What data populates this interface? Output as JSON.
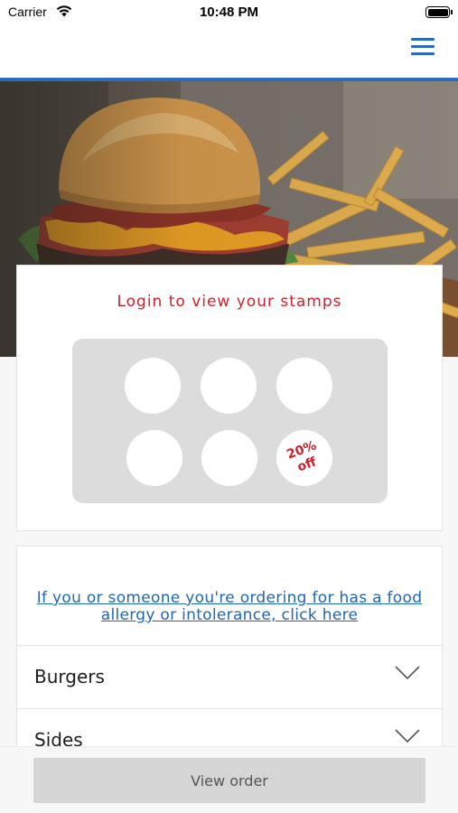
{
  "status_bar": {
    "carrier": "Carrier",
    "time": "10:48 PM",
    "wifi_icon": "wifi-icon",
    "battery_icon": "battery-icon"
  },
  "header": {
    "menu_icon": "hamburger-menu-icon",
    "accent_color": "#2e6bc0"
  },
  "hero": {
    "image": "burger-and-fries-photo"
  },
  "stamps": {
    "title": "Login to view your stamps",
    "stamp_count": 6,
    "reward_line1": "20%",
    "reward_line2": "off",
    "accent_color": "#d0202a"
  },
  "menu": {
    "allergy_link": "If you or someone you're ordering for has a food allergy or intolerance, click here",
    "categories": [
      {
        "label": "Burgers"
      },
      {
        "label": "Sides"
      }
    ],
    "chevron_icon": "chevron-down-icon"
  },
  "footer": {
    "view_order_label": "View order"
  }
}
